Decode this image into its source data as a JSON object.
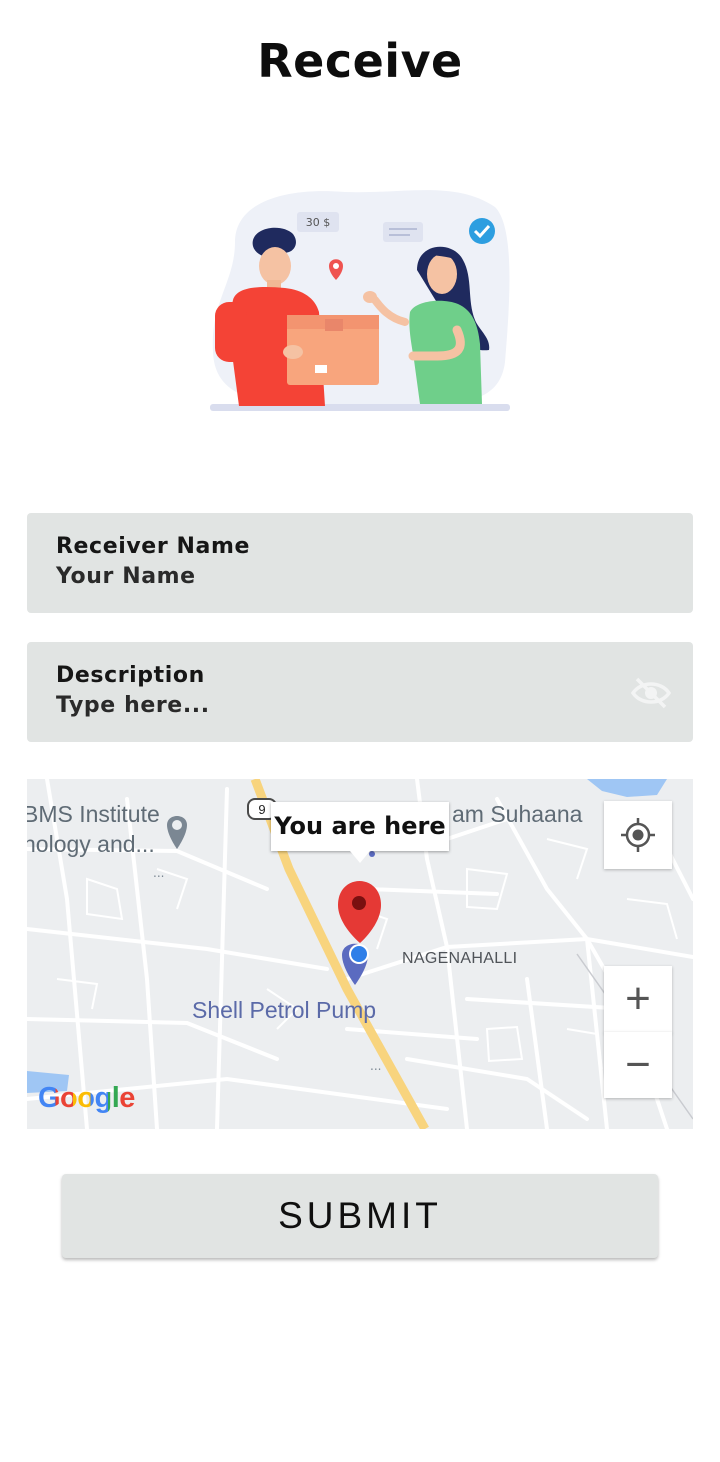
{
  "page": {
    "title": "Receive"
  },
  "illustration": {
    "tag_text": "30 $"
  },
  "receiver_field": {
    "label": "Receiver Name",
    "placeholder": "Your Name"
  },
  "description_field": {
    "label": "Description",
    "placeholder": "Type here..."
  },
  "map": {
    "poi_left_line1": "BMS Institute",
    "poi_left_line2": "nology and...",
    "poi_top_right": "am Suhaana",
    "area_label": "NAGENAHALLI",
    "place_label": "Shell Petrol Pump",
    "marker_tooltip": "You are here",
    "road_shield": "9",
    "attribution": "Google",
    "zoom_in": "+",
    "zoom_out": "−"
  },
  "submit": {
    "label": "SUBMIT"
  },
  "colors": {
    "field_bg": "#e1e4e3",
    "marker_red": "#e53935",
    "road_yellow": "#f8d47e",
    "place_blue": "#5b6aa8"
  }
}
